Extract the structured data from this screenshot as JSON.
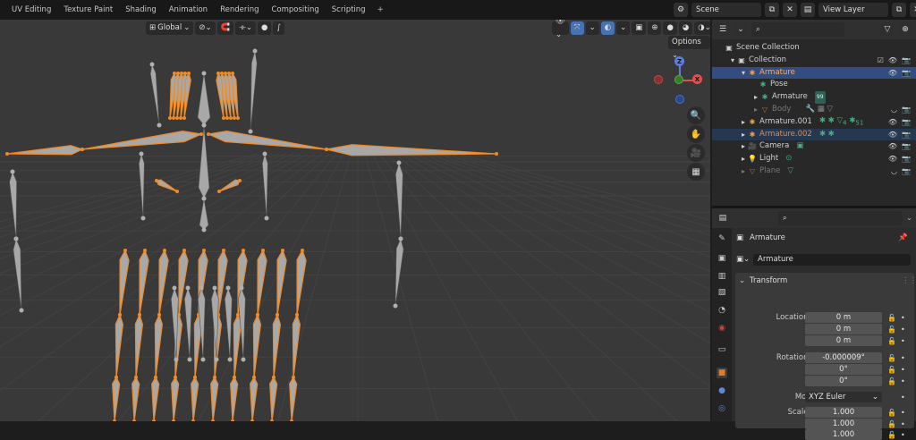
{
  "workspace_tabs": [
    "UV Editing",
    "Texture Paint",
    "Shading",
    "Animation",
    "Rendering",
    "Compositing",
    "Scripting"
  ],
  "add_workspace": "+",
  "scene": {
    "name": "Scene"
  },
  "view_layer": {
    "name": "View Layer"
  },
  "viewport": {
    "orientation_label": "Global",
    "options_label": "Options",
    "gizmo": {
      "z": "Z",
      "x": "X"
    },
    "colors": {
      "background": "#393939",
      "bone": "#a8a8a8",
      "selected_outline": "#f08a24"
    }
  },
  "outliner": {
    "search_placeholder": "",
    "rows": [
      {
        "label": "Scene Collection",
        "icon": "scene-collection-icon"
      },
      {
        "label": "Collection",
        "icon": "collection-icon"
      },
      {
        "label": "Armature",
        "icon": "armature-icon"
      },
      {
        "label": "Pose",
        "icon": "pose-icon"
      },
      {
        "label": "Armature",
        "icon": "armature-data-icon"
      },
      {
        "label": "Body",
        "icon": "mesh-icon"
      },
      {
        "label": "Armature.001",
        "icon": "armature-icon"
      },
      {
        "label": "Armature.002",
        "icon": "armature-icon"
      },
      {
        "label": "Camera",
        "icon": "camera-icon"
      },
      {
        "label": "Light",
        "icon": "light-icon"
      },
      {
        "label": "Plane",
        "icon": "mesh-icon"
      }
    ],
    "badges": {
      "body_child_count": "99",
      "a001_count_1": "4",
      "a001_count_2": "51"
    }
  },
  "properties": {
    "object_name": "Armature",
    "data_name": "Armature",
    "transform_title": "Transform",
    "fields": {
      "location_x_label": "Location X",
      "location_x": "0 m",
      "location_y_label": "Y",
      "location_y": "0 m",
      "location_z_label": "Z",
      "location_z": "0 m",
      "rotation_x_label": "Rotation X",
      "rotation_x": "-0.000009°",
      "rotation_y_label": "Y",
      "rotation_y": "0°",
      "rotation_z_label": "Z",
      "rotation_z": "0°",
      "mode_label": "Mode",
      "mode": "XYZ Euler",
      "scale_x_label": "Scale X",
      "scale_x": "1.000",
      "scale_y_label": "Y",
      "scale_y": "1.000",
      "scale_z_label": "Z",
      "scale_z": "1.000"
    }
  }
}
